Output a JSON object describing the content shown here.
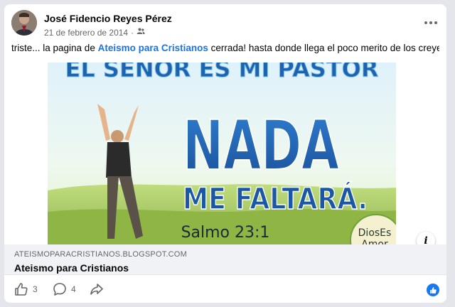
{
  "post": {
    "author": "José Fidencio Reyes Pérez",
    "date": "21 de febrero de 2014",
    "separator": "·",
    "text_before": "triste... la pagina de ",
    "text_link": "Ateismo para Cristianos",
    "text_after": " cerrada! hasta donde llega el poco merito de los creyentes...."
  },
  "image": {
    "line1": "EL SEÑOR ES MI PASTOR",
    "line2": "NADA",
    "line3": "ME FALTARÁ.",
    "line4": "Salmo 23:1",
    "badge_line1": "DiosEs",
    "badge_line2": "Amor"
  },
  "link_card": {
    "domain": "ATEISMOPARACRISTIANOS.BLOGSPOT.COM",
    "title": "Ateismo para Cristianos",
    "info_icon_label": "i"
  },
  "actions": {
    "like_count": "3",
    "comment_count": "4"
  },
  "colors": {
    "accent": "#1b74e4",
    "like_blue": "#1877f2",
    "image_blue": "#1f62b0"
  },
  "icons": [
    "more-icon",
    "audience-friends-icon",
    "like-icon",
    "comment-icon",
    "share-icon",
    "info-icon",
    "like-reaction-icon"
  ]
}
